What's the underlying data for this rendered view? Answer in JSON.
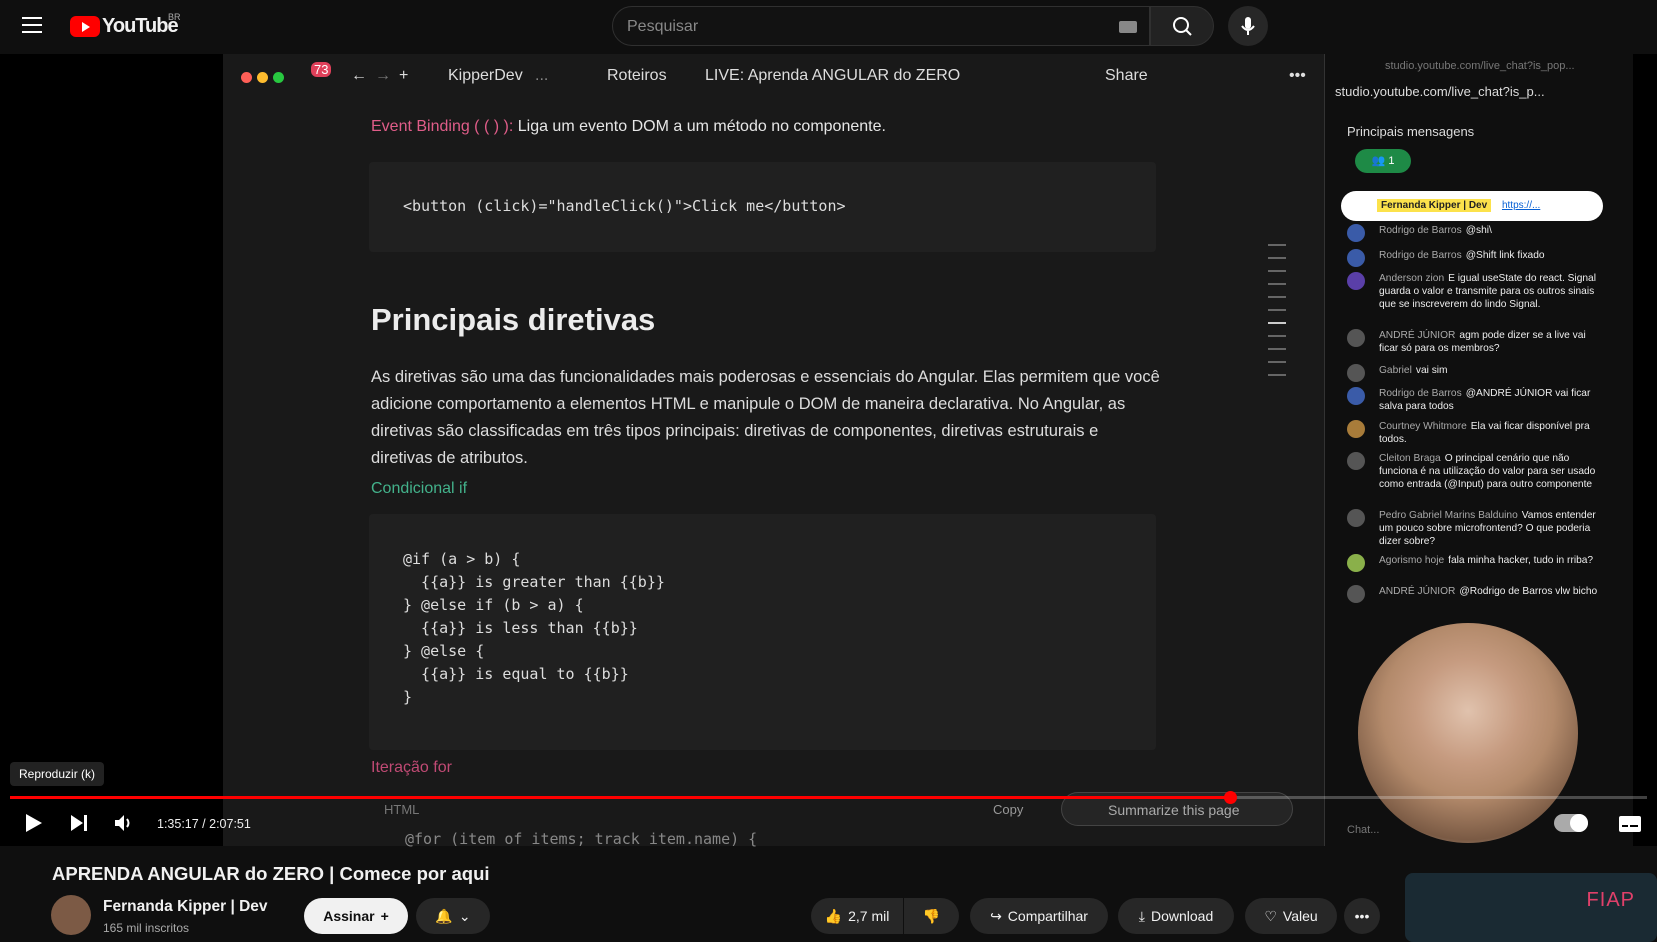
{
  "header": {
    "logo": "YouTube",
    "country": "BR",
    "search_placeholder": "Pesquisar"
  },
  "browser": {
    "tab_count": "73",
    "breadcrumb": [
      "KipperDev",
      "...",
      "Roteiros",
      "LIVE: Aprenda ANGULAR do ZERO"
    ],
    "share_label": "Share"
  },
  "document": {
    "event_binding_label": "Event Binding ( ( ) ):",
    "event_binding_text": "Liga um evento DOM a um método no componente.",
    "code1": "<button (click)=\"handleClick()\">Click me</button>",
    "heading": "Principais diretivas",
    "paragraph": "As diretivas são uma das funcionalidades mais poderosas e essenciais do Angular. Elas permitem que você adicione comportamento a elementos HTML e manipule o DOM de maneira declarativa. No Angular, as diretivas são classificadas em três tipos principais: diretivas de componentes, diretivas estruturais e diretivas de atributos.",
    "subheading": "Condicional if",
    "code2": "@if (a > b) {\n  {{a}} is greater than {{b}}\n} @else if (b > a) {\n  {{a}} is less than {{b}}\n} @else {\n  {{a}} is equal to {{b}}\n}",
    "subheading2": "Iteração for",
    "code_lang": "HTML",
    "copy_label": "Copy",
    "code3_first_line": "@for (item of items; track item.name) {",
    "summarize_label": "Summarize this page"
  },
  "chat": {
    "url_top": "studio.youtube.com/live_chat?is_pop...",
    "url": "studio.youtube.com/live_chat?is_p...",
    "header": "Principais mensagens",
    "pill": "👥 1",
    "pinned_author": "Fernanda Kipper | Dev",
    "pinned_text": "https://...",
    "messages": [
      {
        "author": "Rodrigo de Barros",
        "text": "@shi\\"
      },
      {
        "author": "Rodrigo de Barros",
        "text": "@Shift link fixado"
      },
      {
        "author": "Anderson zion",
        "text": "E igual useState do react. Signal guarda o valor e transmite para os outros sinais que se inscreverem do lindo Signal."
      },
      {
        "author": "ANDRÉ JÚNIOR",
        "text": "agm pode dizer se a live vai ficar só para os membros?"
      },
      {
        "author": "Gabriel",
        "text": "vai sim"
      },
      {
        "author": "Rodrigo de Barros",
        "text": "@ANDRÉ JÚNIOR vai ficar salva para todos"
      },
      {
        "author": "Courtney Whitmore",
        "text": "Ela vai ficar disponível pra todos."
      },
      {
        "author": "Cleiton Braga",
        "text": "O principal cenário que não funciona é na utilização do valor para ser usado como entrada (@Input) para outro componente"
      },
      {
        "author": "Pedro Gabriel Marins Balduino",
        "text": "Vamos entender um pouco sobre microfrontend? O que poderia dizer sobre?"
      },
      {
        "author": "Agorismo hoje",
        "text": "fala minha hacker, tudo in rriba?"
      },
      {
        "author": "ANDRÉ JÚNIOR",
        "text": "@Rodrigo de Barros vlw bicho"
      }
    ],
    "input_placeholder": "Chat..."
  },
  "player": {
    "tooltip": "Reproduzir (k)",
    "time": "1:35:17 / 2:07:51",
    "progress": 0.745
  },
  "video": {
    "title": "APRENDA ANGULAR do ZERO | Comece por aqui",
    "channel": "Fernanda Kipper | Dev",
    "subscribers": "165 mil inscritos",
    "subscribe": "Assinar",
    "likes": "2,7 mil",
    "share": "Compartilhar",
    "download": "Download",
    "thanks": "Valeu",
    "ad_brand": "FIAP"
  }
}
